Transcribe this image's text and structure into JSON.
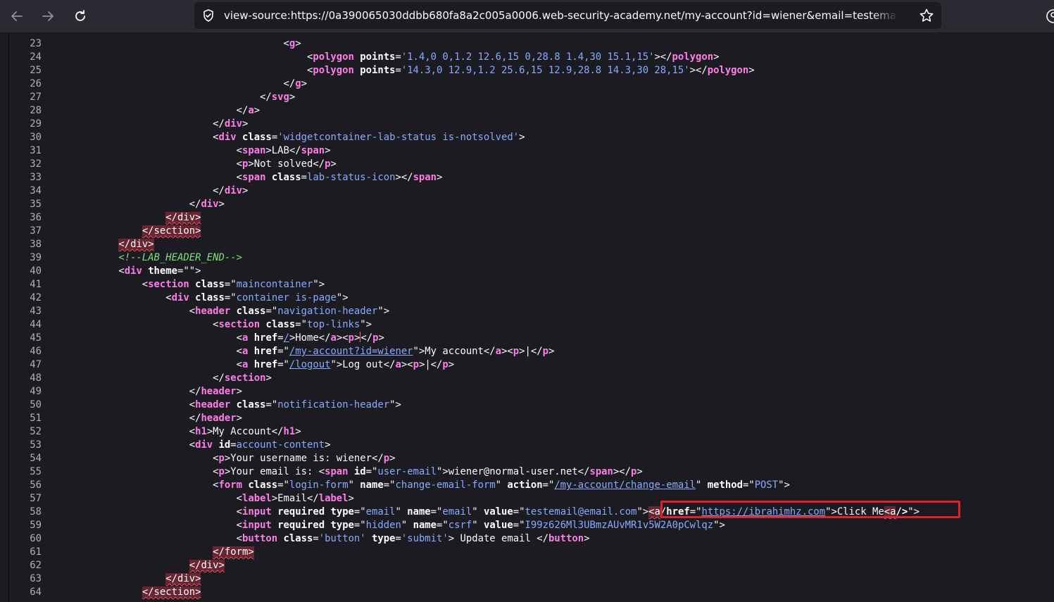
{
  "browser": {
    "url": "view-source:https://0a390065030ddbb680fa8a2c005a0006.web-security-academy.net/my-account?id=wiener&email=testemail@"
  },
  "lines": [
    {
      "n": "23",
      "segs": [
        [
          "p",
          "                                        <"
        ],
        [
          "t",
          "g"
        ],
        [
          "p",
          ">"
        ]
      ]
    },
    {
      "n": "24",
      "segs": [
        [
          "p",
          "                                            <"
        ],
        [
          "t",
          "polygon"
        ],
        [
          "p",
          " "
        ],
        [
          "a",
          "points"
        ],
        [
          "p",
          "="
        ],
        [
          "v",
          "'1.4,0 0,1.2 12.6,15 0,28.8 1.4,30 15.1,15'"
        ],
        [
          "p",
          "></"
        ],
        [
          "t",
          "polygon"
        ],
        [
          "p",
          ">"
        ]
      ]
    },
    {
      "n": "25",
      "segs": [
        [
          "p",
          "                                            <"
        ],
        [
          "t",
          "polygon"
        ],
        [
          "p",
          " "
        ],
        [
          "a",
          "points"
        ],
        [
          "p",
          "="
        ],
        [
          "v",
          "'14.3,0 12.9,1.2 25.6,15 12.9,28.8 14.3,30 28,15'"
        ],
        [
          "p",
          "></"
        ],
        [
          "t",
          "polygon"
        ],
        [
          "p",
          ">"
        ]
      ]
    },
    {
      "n": "26",
      "segs": [
        [
          "p",
          "                                        </"
        ],
        [
          "t",
          "g"
        ],
        [
          "p",
          ">"
        ]
      ]
    },
    {
      "n": "27",
      "segs": [
        [
          "p",
          "                                    </"
        ],
        [
          "t",
          "svg"
        ],
        [
          "p",
          ">"
        ]
      ]
    },
    {
      "n": "28",
      "segs": [
        [
          "p",
          "                                </"
        ],
        [
          "t",
          "a"
        ],
        [
          "p",
          ">"
        ]
      ]
    },
    {
      "n": "29",
      "segs": [
        [
          "p",
          "                            </"
        ],
        [
          "t",
          "div"
        ],
        [
          "p",
          ">"
        ]
      ]
    },
    {
      "n": "30",
      "segs": [
        [
          "p",
          "                            <"
        ],
        [
          "t",
          "div"
        ],
        [
          "p",
          " "
        ],
        [
          "a",
          "class"
        ],
        [
          "p",
          "="
        ],
        [
          "v",
          "'widgetcontainer-lab-status is-notsolved'"
        ],
        [
          "p",
          ">"
        ]
      ]
    },
    {
      "n": "31",
      "segs": [
        [
          "p",
          "                                <"
        ],
        [
          "t",
          "span"
        ],
        [
          "p",
          ">LAB</"
        ],
        [
          "t",
          "span"
        ],
        [
          "p",
          ">"
        ]
      ]
    },
    {
      "n": "32",
      "segs": [
        [
          "p",
          "                                <"
        ],
        [
          "t",
          "p"
        ],
        [
          "p",
          ">Not solved</"
        ],
        [
          "t",
          "p"
        ],
        [
          "p",
          ">"
        ]
      ]
    },
    {
      "n": "33",
      "segs": [
        [
          "p",
          "                                <"
        ],
        [
          "t",
          "span"
        ],
        [
          "p",
          " "
        ],
        [
          "a",
          "class"
        ],
        [
          "p",
          "="
        ],
        [
          "v",
          "lab-status-icon"
        ],
        [
          "p",
          "></"
        ],
        [
          "t",
          "span"
        ],
        [
          "p",
          ">"
        ]
      ]
    },
    {
      "n": "34",
      "segs": [
        [
          "p",
          "                            </"
        ],
        [
          "t",
          "div"
        ],
        [
          "p",
          ">"
        ]
      ]
    },
    {
      "n": "35",
      "segs": [
        [
          "p",
          "                        </"
        ],
        [
          "t",
          "div"
        ],
        [
          "p",
          ">"
        ]
      ]
    },
    {
      "n": "36",
      "segs": [
        [
          "p",
          "                    "
        ],
        [
          "e",
          "</div>"
        ]
      ]
    },
    {
      "n": "37",
      "segs": [
        [
          "p",
          "                "
        ],
        [
          "e",
          "</section>"
        ]
      ]
    },
    {
      "n": "38",
      "segs": [
        [
          "p",
          "            "
        ],
        [
          "e",
          "</div>"
        ]
      ]
    },
    {
      "n": "39",
      "segs": [
        [
          "p",
          "            "
        ],
        [
          "c",
          "<!--LAB_HEADER_END-->"
        ]
      ]
    },
    {
      "n": "40",
      "segs": [
        [
          "p",
          "            <"
        ],
        [
          "t",
          "div"
        ],
        [
          "p",
          " "
        ],
        [
          "a",
          "theme"
        ],
        [
          "p",
          "=\"\">"
        ]
      ]
    },
    {
      "n": "41",
      "segs": [
        [
          "p",
          "                <"
        ],
        [
          "t",
          "section"
        ],
        [
          "p",
          " "
        ],
        [
          "a",
          "class"
        ],
        [
          "p",
          "=\""
        ],
        [
          "v",
          "maincontainer"
        ],
        [
          "p",
          "\">"
        ]
      ]
    },
    {
      "n": "42",
      "segs": [
        [
          "p",
          "                    <"
        ],
        [
          "t",
          "div"
        ],
        [
          "p",
          " "
        ],
        [
          "a",
          "class"
        ],
        [
          "p",
          "=\""
        ],
        [
          "v",
          "container is-page"
        ],
        [
          "p",
          "\">"
        ]
      ]
    },
    {
      "n": "43",
      "segs": [
        [
          "p",
          "                        <"
        ],
        [
          "t",
          "header"
        ],
        [
          "p",
          " "
        ],
        [
          "a",
          "class"
        ],
        [
          "p",
          "=\""
        ],
        [
          "v",
          "navigation-header"
        ],
        [
          "p",
          "\">"
        ]
      ]
    },
    {
      "n": "44",
      "segs": [
        [
          "p",
          "                            <"
        ],
        [
          "t",
          "section"
        ],
        [
          "p",
          " "
        ],
        [
          "a",
          "class"
        ],
        [
          "p",
          "=\""
        ],
        [
          "v",
          "top-links"
        ],
        [
          "p",
          "\">"
        ]
      ]
    },
    {
      "n": "45",
      "segs": [
        [
          "p",
          "                                <"
        ],
        [
          "t",
          "a"
        ],
        [
          "p",
          " "
        ],
        [
          "a",
          "href"
        ],
        [
          "p",
          "="
        ],
        [
          "l",
          "/"
        ],
        [
          "p",
          ">Home</"
        ],
        [
          "t",
          "a"
        ],
        [
          "p",
          "><"
        ],
        [
          "t",
          "p"
        ],
        [
          "p",
          ">"
        ],
        [
          "bar",
          ""
        ],
        [
          "p",
          "</"
        ],
        [
          "t",
          "p"
        ],
        [
          "p",
          ">"
        ]
      ]
    },
    {
      "n": "46",
      "segs": [
        [
          "p",
          "                                <"
        ],
        [
          "t",
          "a"
        ],
        [
          "p",
          " "
        ],
        [
          "a",
          "href"
        ],
        [
          "p",
          "=\""
        ],
        [
          "l",
          "/my-account?id=wiener"
        ],
        [
          "p",
          "\">My account</"
        ],
        [
          "t",
          "a"
        ],
        [
          "p",
          "><"
        ],
        [
          "t",
          "p"
        ],
        [
          "p",
          ">|</"
        ],
        [
          "t",
          "p"
        ],
        [
          "p",
          ">"
        ]
      ]
    },
    {
      "n": "47",
      "segs": [
        [
          "p",
          "                                <"
        ],
        [
          "t",
          "a"
        ],
        [
          "p",
          " "
        ],
        [
          "a",
          "href"
        ],
        [
          "p",
          "=\""
        ],
        [
          "l",
          "/logout"
        ],
        [
          "p",
          "\">Log out</"
        ],
        [
          "t",
          "a"
        ],
        [
          "p",
          "><"
        ],
        [
          "t",
          "p"
        ],
        [
          "p",
          ">|</"
        ],
        [
          "t",
          "p"
        ],
        [
          "p",
          ">"
        ]
      ]
    },
    {
      "n": "48",
      "segs": [
        [
          "p",
          "                            </"
        ],
        [
          "t",
          "section"
        ],
        [
          "p",
          ">"
        ]
      ]
    },
    {
      "n": "49",
      "segs": [
        [
          "p",
          "                        </"
        ],
        [
          "t",
          "header"
        ],
        [
          "p",
          ">"
        ]
      ]
    },
    {
      "n": "50",
      "segs": [
        [
          "p",
          "                        <"
        ],
        [
          "t",
          "header"
        ],
        [
          "p",
          " "
        ],
        [
          "a",
          "class"
        ],
        [
          "p",
          "=\""
        ],
        [
          "v",
          "notification-header"
        ],
        [
          "p",
          "\">"
        ]
      ]
    },
    {
      "n": "51",
      "segs": [
        [
          "p",
          "                        </"
        ],
        [
          "t",
          "header"
        ],
        [
          "p",
          ">"
        ]
      ]
    },
    {
      "n": "52",
      "segs": [
        [
          "p",
          "                        <"
        ],
        [
          "t",
          "h1"
        ],
        [
          "p",
          ">My Account</"
        ],
        [
          "t",
          "h1"
        ],
        [
          "p",
          ">"
        ]
      ]
    },
    {
      "n": "53",
      "segs": [
        [
          "p",
          "                        <"
        ],
        [
          "t",
          "div"
        ],
        [
          "p",
          " "
        ],
        [
          "a",
          "id"
        ],
        [
          "p",
          "="
        ],
        [
          "v",
          "account-content"
        ],
        [
          "p",
          ">"
        ]
      ]
    },
    {
      "n": "54",
      "segs": [
        [
          "p",
          "                            <"
        ],
        [
          "t",
          "p"
        ],
        [
          "p",
          ">Your username is: wiener</"
        ],
        [
          "t",
          "p"
        ],
        [
          "p",
          ">"
        ]
      ]
    },
    {
      "n": "55",
      "segs": [
        [
          "p",
          "                            <"
        ],
        [
          "t",
          "p"
        ],
        [
          "p",
          ">Your email is: <"
        ],
        [
          "t",
          "span"
        ],
        [
          "p",
          " "
        ],
        [
          "a",
          "id"
        ],
        [
          "p",
          "=\""
        ],
        [
          "v",
          "user-email"
        ],
        [
          "p",
          "\">wiener@normal-user.net</"
        ],
        [
          "t",
          "span"
        ],
        [
          "p",
          "></"
        ],
        [
          "t",
          "p"
        ],
        [
          "p",
          ">"
        ]
      ]
    },
    {
      "n": "56",
      "segs": [
        [
          "p",
          "                            <"
        ],
        [
          "t",
          "form"
        ],
        [
          "p",
          " "
        ],
        [
          "a",
          "class"
        ],
        [
          "p",
          "=\""
        ],
        [
          "v",
          "login-form"
        ],
        [
          "p",
          "\" "
        ],
        [
          "a",
          "name"
        ],
        [
          "p",
          "=\""
        ],
        [
          "v",
          "change-email-form"
        ],
        [
          "p",
          "\" "
        ],
        [
          "a",
          "action"
        ],
        [
          "p",
          "=\""
        ],
        [
          "l",
          "/my-account/change-email"
        ],
        [
          "p",
          "\" "
        ],
        [
          "a",
          "method"
        ],
        [
          "p",
          "=\""
        ],
        [
          "v",
          "POST"
        ],
        [
          "p",
          "\">"
        ]
      ]
    },
    {
      "n": "57",
      "segs": [
        [
          "p",
          "                                <"
        ],
        [
          "t",
          "label"
        ],
        [
          "p",
          ">Email</"
        ],
        [
          "t",
          "label"
        ],
        [
          "p",
          ">"
        ]
      ]
    },
    {
      "n": "58",
      "segs": [
        [
          "p",
          "                                <"
        ],
        [
          "t",
          "input"
        ],
        [
          "p",
          " "
        ],
        [
          "a",
          "required"
        ],
        [
          "p",
          " "
        ],
        [
          "a",
          "type"
        ],
        [
          "p",
          "=\""
        ],
        [
          "v",
          "email"
        ],
        [
          "p",
          "\" "
        ],
        [
          "a",
          "name"
        ],
        [
          "p",
          "=\""
        ],
        [
          "v",
          "email"
        ],
        [
          "p",
          "\" "
        ],
        [
          "a",
          "value"
        ],
        [
          "p",
          "=\""
        ],
        [
          "v",
          "testemail@email.com"
        ],
        [
          "p",
          "\">"
        ],
        [
          "e",
          "<a"
        ],
        [
          "p",
          "/"
        ],
        [
          "a",
          "href"
        ],
        [
          "p",
          "=\""
        ],
        [
          "l",
          "https://ibrahimhz.com"
        ],
        [
          "p",
          "\">Click Me"
        ],
        [
          "e",
          "<a"
        ],
        [
          "a",
          "/>"
        ],
        [
          "p",
          "\">"
        ]
      ]
    },
    {
      "n": "59",
      "segs": [
        [
          "p",
          "                                <"
        ],
        [
          "t",
          "input"
        ],
        [
          "p",
          " "
        ],
        [
          "a",
          "required"
        ],
        [
          "p",
          " "
        ],
        [
          "a",
          "type"
        ],
        [
          "p",
          "=\""
        ],
        [
          "v",
          "hidden"
        ],
        [
          "p",
          "\" "
        ],
        [
          "a",
          "name"
        ],
        [
          "p",
          "=\""
        ],
        [
          "v",
          "csrf"
        ],
        [
          "p",
          "\" "
        ],
        [
          "a",
          "value"
        ],
        [
          "p",
          "=\""
        ],
        [
          "v",
          "I99z626Ml3UBmzAUvMR1v5W2A0pCwlqz"
        ],
        [
          "p",
          "\">"
        ]
      ]
    },
    {
      "n": "60",
      "segs": [
        [
          "p",
          "                                <"
        ],
        [
          "t",
          "button"
        ],
        [
          "p",
          " "
        ],
        [
          "a",
          "class"
        ],
        [
          "p",
          "="
        ],
        [
          "v",
          "'button'"
        ],
        [
          "p",
          " "
        ],
        [
          "a",
          "type"
        ],
        [
          "p",
          "="
        ],
        [
          "v",
          "'submit'"
        ],
        [
          "p",
          "> Update email </"
        ],
        [
          "t",
          "button"
        ],
        [
          "p",
          ">"
        ]
      ]
    },
    {
      "n": "61",
      "segs": [
        [
          "p",
          "                            "
        ],
        [
          "e",
          "</form>"
        ]
      ]
    },
    {
      "n": "62",
      "segs": [
        [
          "p",
          "                        "
        ],
        [
          "e",
          "</div>"
        ]
      ]
    },
    {
      "n": "63",
      "segs": [
        [
          "p",
          "                    "
        ],
        [
          "e",
          "</div>"
        ]
      ]
    },
    {
      "n": "64",
      "segs": [
        [
          "p",
          "                "
        ],
        [
          "e",
          "</section>"
        ]
      ]
    }
  ]
}
